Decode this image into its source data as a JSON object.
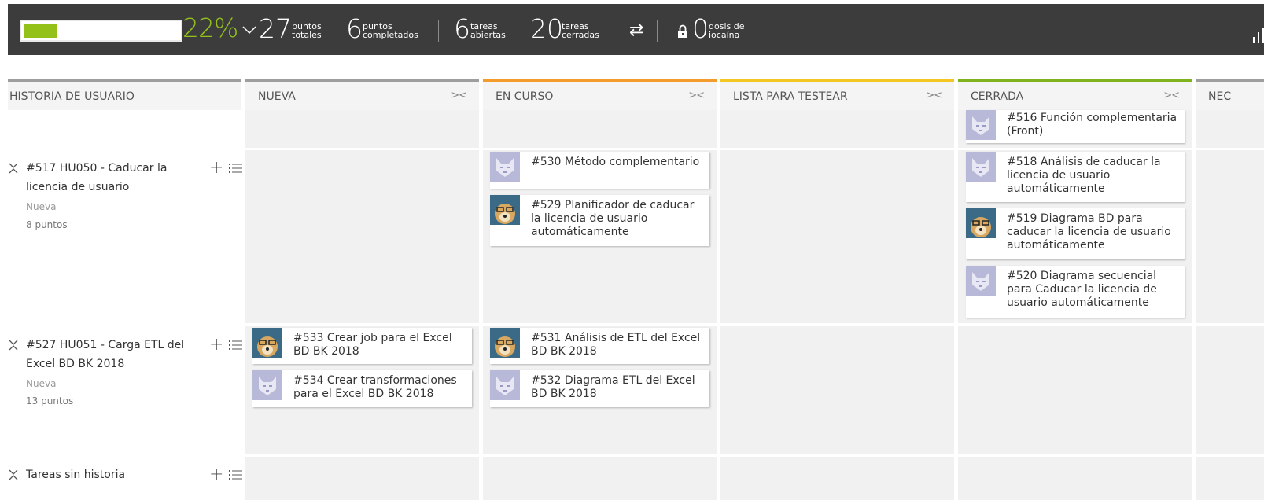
{
  "stats": {
    "progress_fraction": 0.22,
    "progress_color": "#93c11a",
    "percent": "22%",
    "total_points": "27",
    "total_points_label": "puntos\ntotales",
    "completed_points": "6",
    "completed_points_label": "puntos\ncompletados",
    "open_tasks": "6",
    "open_tasks_label": "tareas\nabiertas",
    "closed_tasks": "20",
    "closed_tasks_label": "tareas\ncerradas",
    "iocaine": "0",
    "iocaine_label": "dosis de\niocaína"
  },
  "columns": [
    {
      "label": "HISTORIA DE USUARIO",
      "color": "#9e9e9e"
    },
    {
      "label": "NUEVA",
      "color": "#9e9e9e"
    },
    {
      "label": "EN CURSO",
      "color": "#f39c2b"
    },
    {
      "label": "LISTA PARA TESTEAR",
      "color": "#f3c623"
    },
    {
      "label": "CERRADA",
      "color": "#7fb31e"
    },
    {
      "label": "NEC",
      "color": "#9e9e9e"
    }
  ],
  "fold_symbol": "><",
  "stories": [
    {
      "title": "#517 HU050 - Caducar la licencia de usuario",
      "status": "Nueva",
      "points": "8 puntos"
    },
    {
      "title": "#527 HU051 - Carga ETL del Excel BD BK 2018",
      "status": "Nueva",
      "points": "13 puntos"
    },
    {
      "title": "Tareas sin historia"
    }
  ],
  "add_symbol": "+",
  "cards": {
    "c516": "#516 Función complementaria (Front)",
    "c530": "#530 Método complementario",
    "c529": "#529 Planificador de caducar la licencia de usuario automáticamente",
    "c518": "#518 Análisis de caducar la licencia de usuario automáticamente",
    "c519": "#519 Diagrama BD para caducar la licencia de usuario automáticamente",
    "c520": "#520 Diagrama secuencial para Caducar la licencia de usuario automáticamente",
    "c533": "#533 Crear job para el Excel BD BK 2018",
    "c534": "#534 Crear transformaciones para el Excel BD BK 2018",
    "c531": "#531 Análisis de ETL del Excel BD BK 2018",
    "c532": "#532 Diagrama ETL del Excel BD BK 2018"
  }
}
